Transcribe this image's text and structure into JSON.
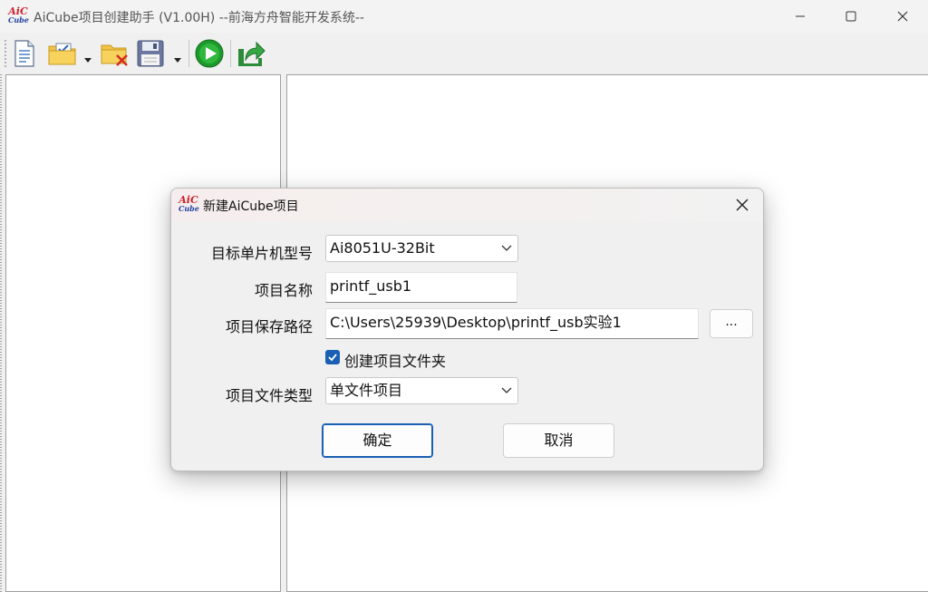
{
  "window": {
    "title": "AiCube项目创建助手 (V1.00H) --前海方舟智能开发系统--",
    "logo_top": "AiC",
    "logo_bottom": "Cube"
  },
  "toolbar": {
    "items": [
      {
        "name": "new-file",
        "icon": "document-icon"
      },
      {
        "name": "open-project",
        "icon": "folder-check-icon",
        "dropdown": true
      },
      {
        "name": "close-project",
        "icon": "folder-delete-icon"
      },
      {
        "name": "save",
        "icon": "floppy-disk-icon",
        "dropdown": true
      },
      {
        "name": "run",
        "icon": "play-icon"
      },
      {
        "name": "export",
        "icon": "share-arrow-icon"
      }
    ]
  },
  "dialog": {
    "title": "新建AiCube项目",
    "logo_top": "AiC",
    "logo_bottom": "Cube",
    "mcu_label": "目标单片机型号",
    "mcu_value": "Ai8051U-32Bit",
    "name_label": "项目名称",
    "name_value": "printf_usb1",
    "path_label": "项目保存路径",
    "path_value": "C:\\Users\\25939\\Desktop\\printf_usb实验1",
    "browse_label": "...",
    "create_folder_label": "创建项目文件夹",
    "create_folder_checked": true,
    "filetype_label": "项目文件类型",
    "filetype_value": "单文件项目",
    "ok_label": "确定",
    "cancel_label": "取消"
  },
  "colors": {
    "accent": "#1a5fb4",
    "logo_red": "#d0202a",
    "logo_blue": "#1f3f9e",
    "run_green": "#1e9a2c"
  }
}
